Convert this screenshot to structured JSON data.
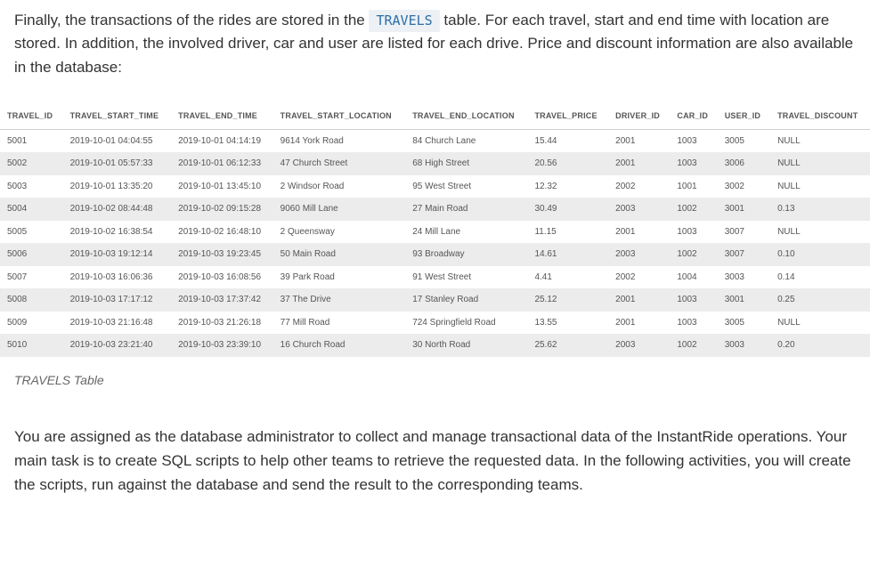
{
  "intro": {
    "before_chip": "Finally, the transactions of the rides are stored in the ",
    "chip": "TRAVELS",
    "after_chip": " table. For each travel, start and end time with location are stored. In addition, the involved driver, car and user are listed for each drive. Price and discount information are also available in the database:"
  },
  "table": {
    "headers": [
      "TRAVEL_ID",
      "TRAVEL_START_TIME",
      "TRAVEL_END_TIME",
      "TRAVEL_START_LOCATION",
      "TRAVEL_END_LOCATION",
      "TRAVEL_PRICE",
      "DRIVER_ID",
      "CAR_ID",
      "USER_ID",
      "TRAVEL_DISCOUNT"
    ],
    "rows": [
      [
        "5001",
        "2019-10-01 04:04:55",
        "2019-10-01 04:14:19",
        "9614 York Road",
        "84 Church Lane",
        "15.44",
        "2001",
        "1003",
        "3005",
        "NULL"
      ],
      [
        "5002",
        "2019-10-01 05:57:33",
        "2019-10-01 06:12:33",
        "47 Church Street",
        "68 High Street",
        "20.56",
        "2001",
        "1003",
        "3006",
        "NULL"
      ],
      [
        "5003",
        "2019-10-01 13:35:20",
        "2019-10-01 13:45:10",
        "2 Windsor Road",
        "95 West Street",
        "12.32",
        "2002",
        "1001",
        "3002",
        "NULL"
      ],
      [
        "5004",
        "2019-10-02 08:44:48",
        "2019-10-02 09:15:28",
        "9060 Mill Lane",
        "27 Main Road",
        "30.49",
        "2003",
        "1002",
        "3001",
        "0.13"
      ],
      [
        "5005",
        "2019-10-02 16:38:54",
        "2019-10-02 16:48:10",
        "2 Queensway",
        "24 Mill Lane",
        "11.15",
        "2001",
        "1003",
        "3007",
        "NULL"
      ],
      [
        "5006",
        "2019-10-03 19:12:14",
        "2019-10-03 19:23:45",
        "50 Main Road",
        "93 Broadway",
        "14.61",
        "2003",
        "1002",
        "3007",
        "0.10"
      ],
      [
        "5007",
        "2019-10-03 16:06:36",
        "2019-10-03 16:08:56",
        "39 Park Road",
        "91 West Street",
        "4.41",
        "2002",
        "1004",
        "3003",
        "0.14"
      ],
      [
        "5008",
        "2019-10-03 17:17:12",
        "2019-10-03 17:37:42",
        "37 The Drive",
        "17 Stanley Road",
        "25.12",
        "2001",
        "1003",
        "3001",
        "0.25"
      ],
      [
        "5009",
        "2019-10-03 21:16:48",
        "2019-10-03 21:26:18",
        "77 Mill Road",
        "724 Springfield Road",
        "13.55",
        "2001",
        "1003",
        "3005",
        "NULL"
      ],
      [
        "5010",
        "2019-10-03 23:21:40",
        "2019-10-03 23:39:10",
        "16 Church Road",
        "30 North Road",
        "25.62",
        "2003",
        "1002",
        "3003",
        "0.20"
      ]
    ]
  },
  "caption": "TRAVELS Table",
  "closing": "You are assigned as the database administrator to collect and manage transactional data of the InstantRide operations. Your main task is to create SQL scripts to help other teams to retrieve the requested data. In the following activities, you will create the scripts, run against the database and send the result to the corresponding teams."
}
